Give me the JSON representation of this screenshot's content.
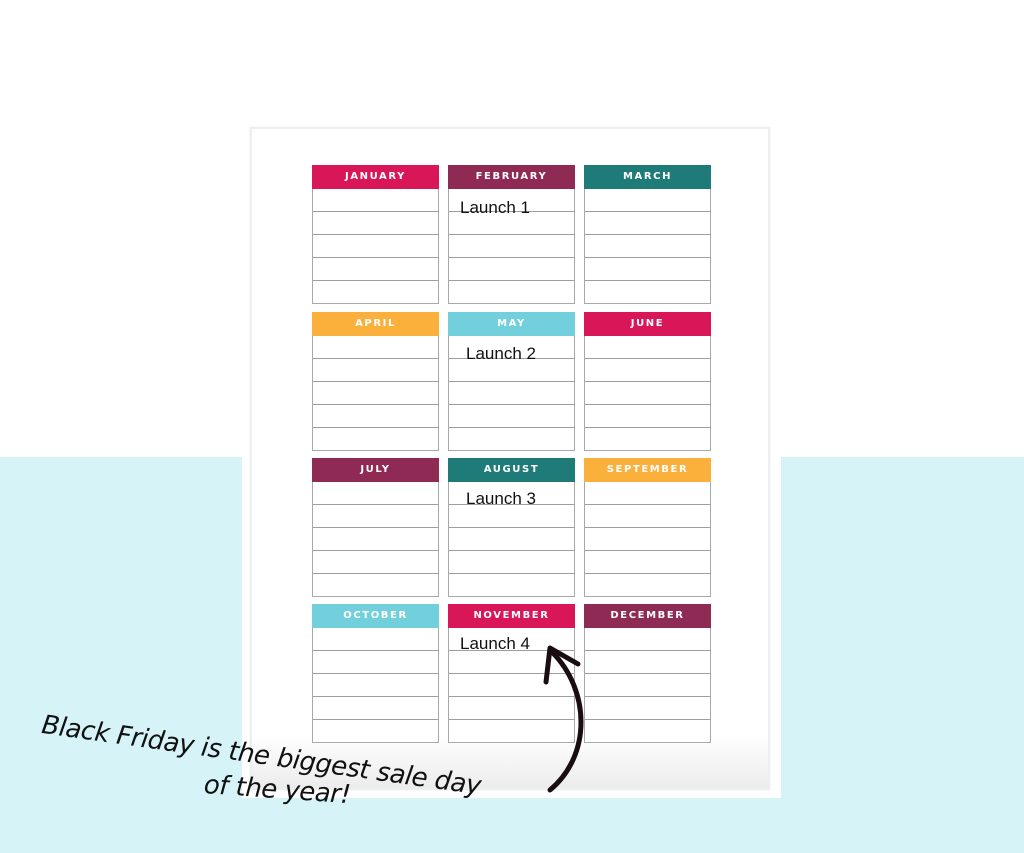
{
  "planner": {
    "months": [
      {
        "name": "JANUARY",
        "color": "#d91657",
        "entry": ""
      },
      {
        "name": "FEBRUARY",
        "color": "#8e2a53",
        "entry": "Launch 1"
      },
      {
        "name": "MARCH",
        "color": "#1f7b78",
        "entry": ""
      },
      {
        "name": "APRIL",
        "color": "#fbb03b",
        "entry": ""
      },
      {
        "name": "MAY",
        "color": "#72d0dd",
        "entry": "Launch 2"
      },
      {
        "name": "JUNE",
        "color": "#d91657",
        "entry": ""
      },
      {
        "name": "JULY",
        "color": "#8e2a53",
        "entry": ""
      },
      {
        "name": "AUGUST",
        "color": "#1f7b78",
        "entry": "Launch 3"
      },
      {
        "name": "SEPTEMBER",
        "color": "#fbb03b",
        "entry": ""
      },
      {
        "name": "OCTOBER",
        "color": "#72d0dd",
        "entry": ""
      },
      {
        "name": "NOVEMBER",
        "color": "#d91657",
        "entry": "Launch 4"
      },
      {
        "name": "DECEMBER",
        "color": "#8e2a53",
        "entry": ""
      }
    ],
    "rows_per_month": 5
  },
  "annotation": {
    "line1": "Black Friday is the biggest sale day",
    "line2": "of the year!",
    "arrow_icon": "curved-arrow-up-icon",
    "points_to": "NOVEMBER"
  },
  "colors": {
    "background_band": "#d6f3f7",
    "paper": "#ffffff"
  }
}
